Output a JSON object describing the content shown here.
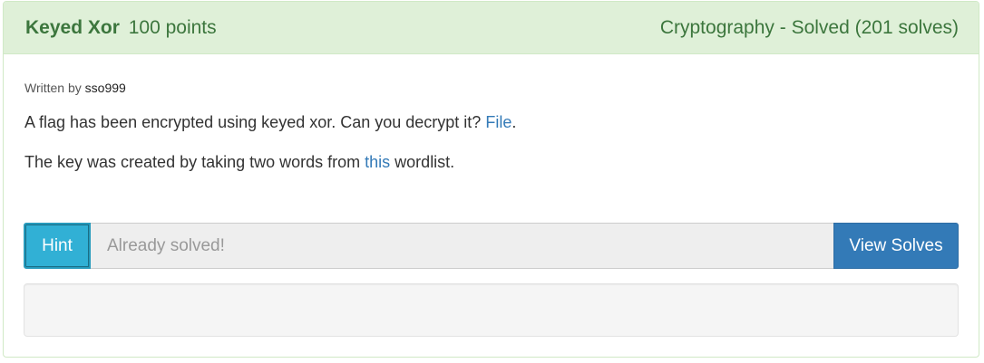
{
  "problem": {
    "name": "Keyed Xor",
    "points": "100 points",
    "status": "Cryptography - Solved (201 solves)",
    "author_prefix": "Written by",
    "author": "sso999",
    "desc1_text": "A flag has been encrypted using keyed xor. Can you decrypt it? ",
    "desc1_link": "File",
    "desc1_end": ".",
    "desc2_text": "The key was created by taking two words from ",
    "desc2_link": "this",
    "desc2_end": " wordlist."
  },
  "answer": {
    "hint_label": "Hint",
    "placeholder": "Already solved!",
    "view_solves_label": "View Solves"
  },
  "colors": {
    "header_bg": "#dff0d8",
    "header_text": "#3c763d",
    "hint_button": "#31b0d5",
    "solves_button": "#337ab7",
    "link": "#337ab7"
  }
}
